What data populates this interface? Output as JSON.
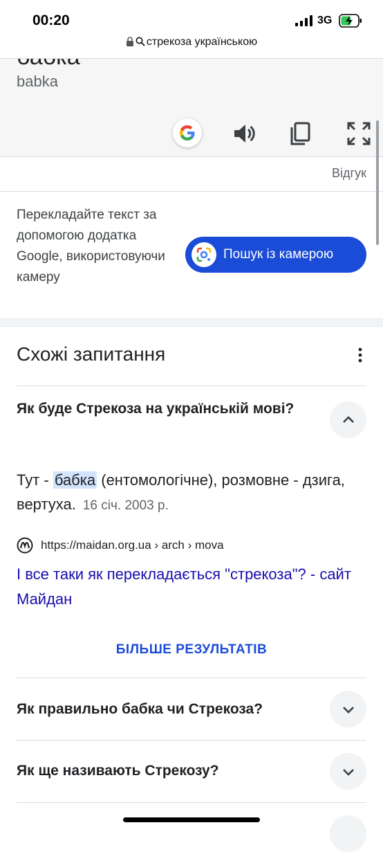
{
  "status": {
    "time": "00:20",
    "network": "3G"
  },
  "url": {
    "text": "стрекоза українською"
  },
  "translation": {
    "word": "бабка",
    "transliteration": "babka"
  },
  "feedback": {
    "label": "Відгук"
  },
  "promo": {
    "text": "Перекладайте текст за допомогою додатка Google, використовуючи камеру",
    "button_label": "Пошук із камерою"
  },
  "paa": {
    "title": "Схожі запитання",
    "questions": [
      {
        "text": "Як буде Стрекоза на українській мові?",
        "expanded": true
      },
      {
        "text": "Як правильно бабка чи Стрекоза?",
        "expanded": false
      },
      {
        "text": "Як ще називають Стрекозу?",
        "expanded": false
      }
    ],
    "answer": {
      "prefix": "Тут - ",
      "highlight": "бабка",
      "suffix": " (ентомологічне), розмовне - дзига, вертуха.",
      "date": "16 січ. 2003 р."
    },
    "source": {
      "url": "https://maidan.org.ua › arch › mova",
      "link_text": "І все таки як перекладається \"стрекоза\"? - сайт Майдан"
    },
    "more_results": "БІЛЬШЕ РЕЗУЛЬТАТІВ"
  },
  "colors": {
    "accent": "#1a4cd8",
    "link": "#1a0dab",
    "panel_bg": "#f5f6f5"
  }
}
